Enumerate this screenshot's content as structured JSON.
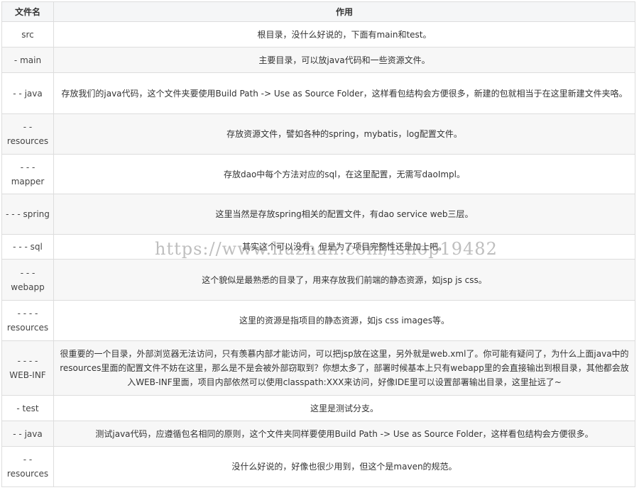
{
  "table": {
    "headers": [
      "文件名",
      "作用"
    ],
    "rows": [
      {
        "name": "src",
        "desc": "根目录，没什么好说的，下面有main和test。"
      },
      {
        "name": "- main",
        "desc": "主要目录，可以放java代码和一些资源文件。"
      },
      {
        "name": "- - java",
        "desc": "存放我们的java代码，这个文件夹要使用Build Path -> Use as Source Folder，这样看包结构会方便很多，新建的包就相当于在这里新建文件夹咯。"
      },
      {
        "name": "- - resources",
        "desc": "存放资源文件，譬如各种的spring，mybatis，log配置文件。"
      },
      {
        "name": "- - - mapper",
        "desc": "存放dao中每个方法对应的sql，在这里配置，无需写daoImpl。"
      },
      {
        "name": "- - - spring",
        "desc": "这里当然是存放spring相关的配置文件，有dao service web三层。"
      },
      {
        "name": "- - - sql",
        "desc": "其实这个可以没有，但是为了项目完整性还是加上吧。"
      },
      {
        "name": "- - - webapp",
        "desc": "这个貌似是最熟悉的目录了，用来存放我们前端的静态资源，如jsp js css。"
      },
      {
        "name": "- - - - resources",
        "desc": "这里的资源是指项目的静态资源，如js css images等。"
      },
      {
        "name": "- - - - WEB-INF",
        "desc": "很重要的一个目录，外部浏览器无法访问，只有羡慕内部才能访问，可以把jsp放在这里，另外就是web.xml了。你可能有疑问了，为什么上面java中的resources里面的配置文件不妨在这里，那么是不是会被外部窃取到？你想太多了，部署时候基本上只有webapp里的会直接输出到根目录，其他都会放入WEB-INF里面，项目内部依然可以使用classpath:XXX来访问，好像IDE里可以设置部署输出目录，这里扯远了~"
      },
      {
        "name": "- test",
        "desc": "这里是测试分支。"
      },
      {
        "name": "- - java",
        "desc": "测试java代码，应遵循包名相同的原则，这个文件夹同样要使用Build Path -> Use as Source Folder，这样看包结构会方便很多。"
      },
      {
        "name": "- - resources",
        "desc": "没什么好说的，好像也很少用到，但这个是maven的规范。"
      }
    ]
  },
  "watermark": "https://www.huzhan.com/ishop19482"
}
